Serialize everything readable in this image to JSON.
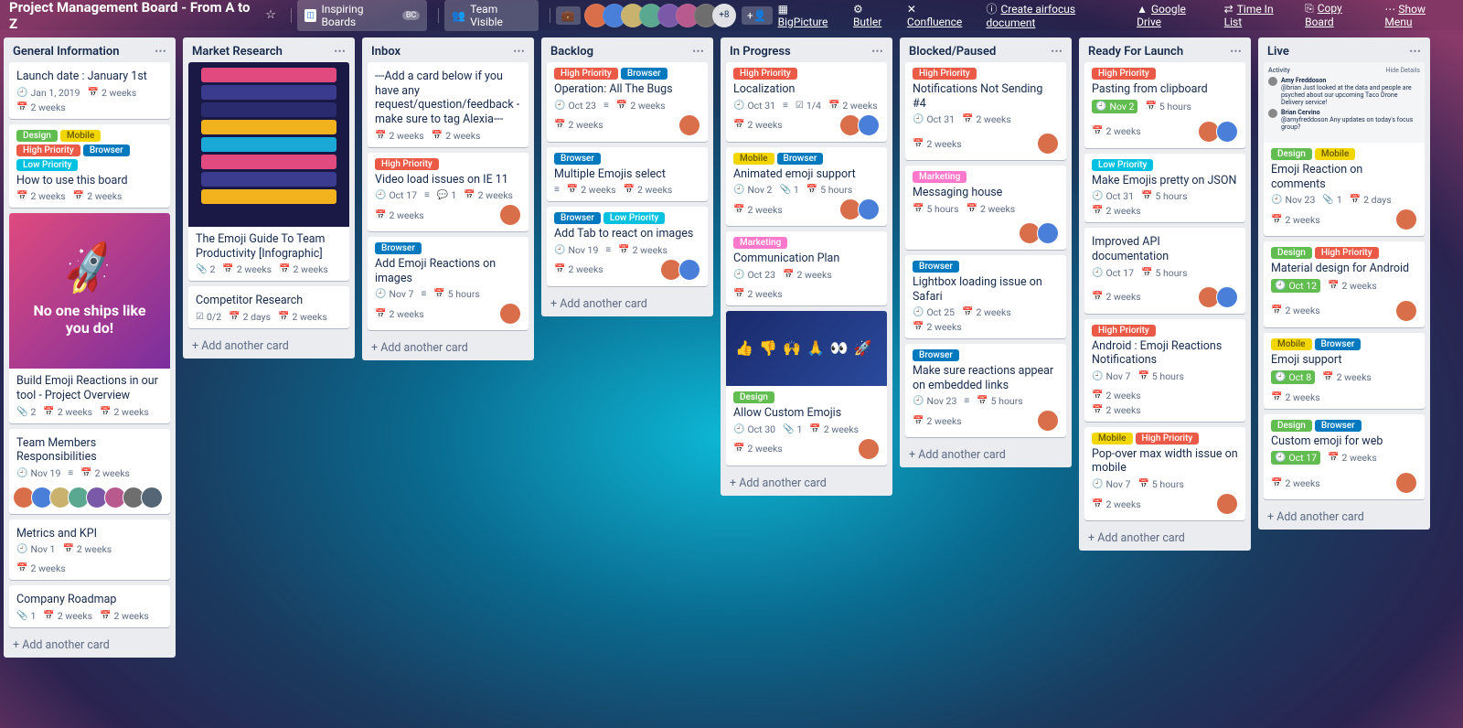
{
  "header": {
    "board_title": "Project Management Board - From A to Z",
    "inspiring": "Inspiring Boards",
    "inspiring_badge": "BC",
    "visibility": "Team Visible",
    "member_count_extra": "8",
    "powerups": [
      {
        "icon": "▦",
        "label": "BigPicture"
      },
      {
        "icon": "⚙",
        "label": "Butler"
      },
      {
        "icon": "✕",
        "label": "Confluence"
      },
      {
        "icon": "ⓘ",
        "label": "Create airfocus document"
      },
      {
        "icon": "▲",
        "label": "Google Drive"
      },
      {
        "icon": "⇄",
        "label": "Time In List"
      },
      {
        "icon": "⎘",
        "label": "Copy Board"
      }
    ],
    "show_menu": "Show Menu"
  },
  "avatar_colors": [
    "#d96e4a",
    "#4a7fd9",
    "#c9b26e",
    "#5aa890",
    "#7a5aa8",
    "#b85a8e",
    "#6e6e6e",
    "#556677"
  ],
  "add_card_label": "Add another card",
  "label_colors": {
    "Design": "l-green",
    "Mobile": "l-yellow",
    "High Priority": "l-red",
    "Browser": "l-blue",
    "Low Priority": "l-sky",
    "Marketing": "l-pink"
  },
  "cover_texts": {
    "rocket_line": "No one ships like you do!",
    "activity_header": "Activity",
    "activity_hide": "Hide Details",
    "activity_rows": [
      {
        "name": "Amy Freddoson",
        "text": "@brian Just looked at the data and people are psyched about our upcoming Taco Drone Delivery service!"
      },
      {
        "name": "Brian Cervino",
        "text": "@amyfreddoson Any updates on today's focus group?"
      }
    ]
  },
  "lists": [
    {
      "name": "General Information",
      "cards": [
        {
          "title": "Launch date : January 1st",
          "badges": [
            {
              "t": "clock",
              "v": "Jan 1, 2019"
            },
            {
              "t": "cal",
              "v": "2 weeks"
            }
          ],
          "row2": [
            {
              "t": "cal",
              "v": "2 weeks"
            }
          ]
        },
        {
          "labels": [
            "Design",
            "Mobile",
            "High Priority",
            "Browser",
            "Low Priority"
          ],
          "title": "How to use this board",
          "row2": [
            {
              "t": "cal",
              "v": "2 weeks"
            },
            {
              "t": "cal",
              "v": "2 weeks"
            }
          ]
        },
        {
          "cover": "rocket",
          "title": "Build Emoji Reactions in our tool - Project Overview",
          "badges": [
            {
              "t": "att",
              "v": "2"
            },
            {
              "t": "cal",
              "v": "2 weeks"
            },
            {
              "t": "cal",
              "v": "2 weeks"
            }
          ]
        },
        {
          "title": "Team Members Responsibilities",
          "badges": [
            {
              "t": "clock",
              "v": "Nov 19"
            },
            {
              "t": "desc"
            },
            {
              "t": "cal",
              "v": "2 weeks"
            }
          ],
          "members": 8
        },
        {
          "title": "Metrics and KPI",
          "badges": [
            {
              "t": "clock",
              "v": "Nov 1"
            },
            {
              "t": "cal",
              "v": "2 weeks"
            },
            {
              "t": "cal",
              "v": "2 weeks"
            }
          ]
        },
        {
          "title": "Company Roadmap",
          "badges": [
            {
              "t": "att",
              "v": "1"
            },
            {
              "t": "cal",
              "v": "2 weeks"
            },
            {
              "t": "cal",
              "v": "2 weeks"
            }
          ]
        }
      ]
    },
    {
      "name": "Market Research",
      "cards": [
        {
          "cover": "info",
          "title": "The Emoji Guide To Team Productivity [Infographic]",
          "badges": [
            {
              "t": "att",
              "v": "2"
            },
            {
              "t": "cal",
              "v": "2 weeks"
            },
            {
              "t": "cal",
              "v": "2 weeks"
            }
          ]
        },
        {
          "title": "Competitor Research",
          "badges": [
            {
              "t": "check",
              "v": "0/2"
            },
            {
              "t": "cal",
              "v": "2 days"
            },
            {
              "t": "cal",
              "v": "2 weeks"
            }
          ]
        }
      ]
    },
    {
      "name": "Inbox",
      "cards": [
        {
          "title": "---Add a card below if you have any request/question/feedback - make sure to tag Alexia---",
          "row2": [
            {
              "t": "cal",
              "v": "2 weeks"
            },
            {
              "t": "cal",
              "v": "2 weeks"
            }
          ]
        },
        {
          "labels": [
            "High Priority"
          ],
          "title": "Video load issues on IE 11",
          "badges": [
            {
              "t": "clock",
              "v": "Oct 17"
            },
            {
              "t": "desc"
            },
            {
              "t": "comm",
              "v": "1"
            },
            {
              "t": "cal",
              "v": "2 weeks"
            }
          ],
          "row2": [
            {
              "t": "cal",
              "v": "2 weeks"
            }
          ],
          "members": 1
        },
        {
          "labels": [
            "Browser"
          ],
          "title": "Add Emoji Reactions on images",
          "badges": [
            {
              "t": "clock",
              "v": "Nov 7"
            },
            {
              "t": "desc"
            },
            {
              "t": "cal",
              "v": "5 hours"
            }
          ],
          "row2": [
            {
              "t": "cal",
              "v": "2 weeks"
            }
          ],
          "members": 1
        }
      ]
    },
    {
      "name": "Backlog",
      "cards": [
        {
          "labels": [
            "High Priority",
            "Browser"
          ],
          "title": "Operation: All The Bugs",
          "badges": [
            {
              "t": "clock",
              "v": "Oct 23"
            },
            {
              "t": "desc"
            },
            {
              "t": "cal",
              "v": "2 weeks"
            }
          ],
          "row2": [
            {
              "t": "cal",
              "v": "2 weeks"
            }
          ],
          "members": 1
        },
        {
          "labels": [
            "Browser"
          ],
          "title": "Multiple Emojis select",
          "badges": [
            {
              "t": "desc"
            },
            {
              "t": "cal",
              "v": "2 weeks"
            },
            {
              "t": "cal",
              "v": "2 weeks"
            }
          ]
        },
        {
          "labels": [
            "Browser",
            "Low Priority"
          ],
          "title": "Add Tab to react on images",
          "badges": [
            {
              "t": "clock",
              "v": "Nov 19"
            },
            {
              "t": "desc"
            },
            {
              "t": "cal",
              "v": "2 weeks"
            }
          ],
          "row2": [
            {
              "t": "cal",
              "v": "2 weeks"
            }
          ],
          "members": 2
        }
      ]
    },
    {
      "name": "In Progress",
      "cards": [
        {
          "labels": [
            "High Priority"
          ],
          "title": "Localization",
          "badges": [
            {
              "t": "clock",
              "v": "Oct 31"
            },
            {
              "t": "desc"
            },
            {
              "t": "check",
              "v": "1/4"
            },
            {
              "t": "cal",
              "v": "2 weeks"
            }
          ],
          "row2": [
            {
              "t": "cal",
              "v": "2 weeks"
            }
          ],
          "members": 2
        },
        {
          "labels": [
            "Mobile",
            "Browser"
          ],
          "title": "Animated emoji support",
          "badges": [
            {
              "t": "clock",
              "v": "Nov 2"
            },
            {
              "t": "att",
              "v": "1"
            },
            {
              "t": "cal",
              "v": "5 hours"
            }
          ],
          "row2": [
            {
              "t": "cal",
              "v": "2 weeks"
            }
          ],
          "members": 2
        },
        {
          "labels": [
            "Marketing"
          ],
          "title": "Communication Plan",
          "badges": [
            {
              "t": "clock",
              "v": "Oct 23"
            },
            {
              "t": "cal",
              "v": "2 weeks"
            },
            {
              "t": "cal",
              "v": "2 weeks"
            }
          ]
        },
        {
          "cover": "emoji",
          "labels": [
            "Design"
          ],
          "title": "Allow Custom Emojis",
          "badges": [
            {
              "t": "clock",
              "v": "Oct 30"
            },
            {
              "t": "att",
              "v": "1"
            },
            {
              "t": "cal",
              "v": "2 weeks"
            }
          ],
          "row2": [
            {
              "t": "cal",
              "v": "2 weeks"
            }
          ],
          "members": 1
        }
      ]
    },
    {
      "name": "Blocked/Paused",
      "cards": [
        {
          "labels": [
            "High Priority"
          ],
          "title": "Notifications Not Sending #4",
          "badges": [
            {
              "t": "clock",
              "v": "Oct 31"
            },
            {
              "t": "cal",
              "v": "2 weeks"
            },
            {
              "t": "cal",
              "v": "2 weeks"
            }
          ],
          "members": 1
        },
        {
          "labels": [
            "Marketing"
          ],
          "title": "Messaging house",
          "badges": [
            {
              "t": "cal",
              "v": "5 hours"
            },
            {
              "t": "cal",
              "v": "2 weeks"
            }
          ],
          "members": 2
        },
        {
          "labels": [
            "Browser"
          ],
          "title": "Lightbox loading issue on Safari",
          "badges": [
            {
              "t": "clock",
              "v": "Oct 25"
            },
            {
              "t": "cal",
              "v": "2 weeks"
            }
          ],
          "row2": [
            {
              "t": "cal",
              "v": "2 weeks"
            }
          ]
        },
        {
          "labels": [
            "Browser"
          ],
          "title": "Make sure reactions appear on embedded links",
          "badges": [
            {
              "t": "clock",
              "v": "Nov 23"
            },
            {
              "t": "desc"
            },
            {
              "t": "cal",
              "v": "5 hours"
            }
          ],
          "row2": [
            {
              "t": "cal",
              "v": "2 weeks"
            }
          ],
          "members": 1
        }
      ]
    },
    {
      "name": "Ready For Launch",
      "cards": [
        {
          "labels": [
            "High Priority"
          ],
          "title": "Pasting from clipboard",
          "badges": [
            {
              "t": "due-g",
              "v": "Nov 2"
            },
            {
              "t": "cal",
              "v": "5 hours"
            },
            {
              "t": "cal",
              "v": "2 weeks"
            }
          ],
          "members": 2
        },
        {
          "labels": [
            "Low Priority"
          ],
          "title": "Make Emojis pretty on JSON",
          "badges": [
            {
              "t": "clock",
              "v": "Oct 31"
            },
            {
              "t": "cal",
              "v": "5 hours"
            }
          ],
          "row2": [
            {
              "t": "cal",
              "v": "2 weeks"
            }
          ]
        },
        {
          "title": "Improved API documentation",
          "badges": [
            {
              "t": "clock",
              "v": "Oct 17"
            },
            {
              "t": "cal",
              "v": "5 hours"
            },
            {
              "t": "cal",
              "v": "2 weeks"
            }
          ],
          "members": 2
        },
        {
          "labels": [
            "High Priority"
          ],
          "title": "Android : Emoji Reactions Notifications",
          "badges": [
            {
              "t": "clock",
              "v": "Nov 7"
            },
            {
              "t": "cal",
              "v": "5 hours"
            },
            {
              "t": "cal",
              "v": "2 weeks"
            }
          ],
          "row2": [
            {
              "t": "cal",
              "v": "2 weeks"
            }
          ]
        },
        {
          "labels": [
            "Mobile",
            "High Priority"
          ],
          "title": "Pop-over max width issue on mobile",
          "badges": [
            {
              "t": "clock",
              "v": "Nov 7"
            },
            {
              "t": "cal",
              "v": "5 hours"
            }
          ],
          "row2": [
            {
              "t": "cal",
              "v": "2 weeks"
            }
          ],
          "members": 1
        }
      ]
    },
    {
      "name": "Live",
      "cards": [
        {
          "cover": "activity",
          "labels": [
            "Design",
            "Mobile"
          ],
          "title": "Emoji Reaction on comments",
          "badges": [
            {
              "t": "clock",
              "v": "Nov 23"
            },
            {
              "t": "att",
              "v": "1"
            },
            {
              "t": "cal",
              "v": "2 days"
            }
          ],
          "row2": [
            {
              "t": "cal",
              "v": "2 weeks"
            }
          ],
          "members": 1
        },
        {
          "labels": [
            "Design",
            "High Priority"
          ],
          "title": "Material design for Android",
          "badges": [
            {
              "t": "due-g",
              "v": "Oct 12"
            },
            {
              "t": "cal",
              "v": "2 weeks"
            },
            {
              "t": "cal",
              "v": "2 weeks"
            }
          ],
          "members": 1
        },
        {
          "labels": [
            "Mobile",
            "Browser"
          ],
          "title": "Emoji support",
          "badges": [
            {
              "t": "due-g",
              "v": "Oct 8"
            },
            {
              "t": "cal",
              "v": "2 weeks"
            },
            {
              "t": "cal",
              "v": "2 weeks"
            }
          ]
        },
        {
          "labels": [
            "Design",
            "Browser"
          ],
          "title": "Custom emoji for web",
          "badges": [
            {
              "t": "due-g",
              "v": "Oct 17"
            },
            {
              "t": "cal",
              "v": "2 weeks"
            },
            {
              "t": "cal",
              "v": "2 weeks"
            }
          ],
          "members": 1
        }
      ]
    }
  ]
}
